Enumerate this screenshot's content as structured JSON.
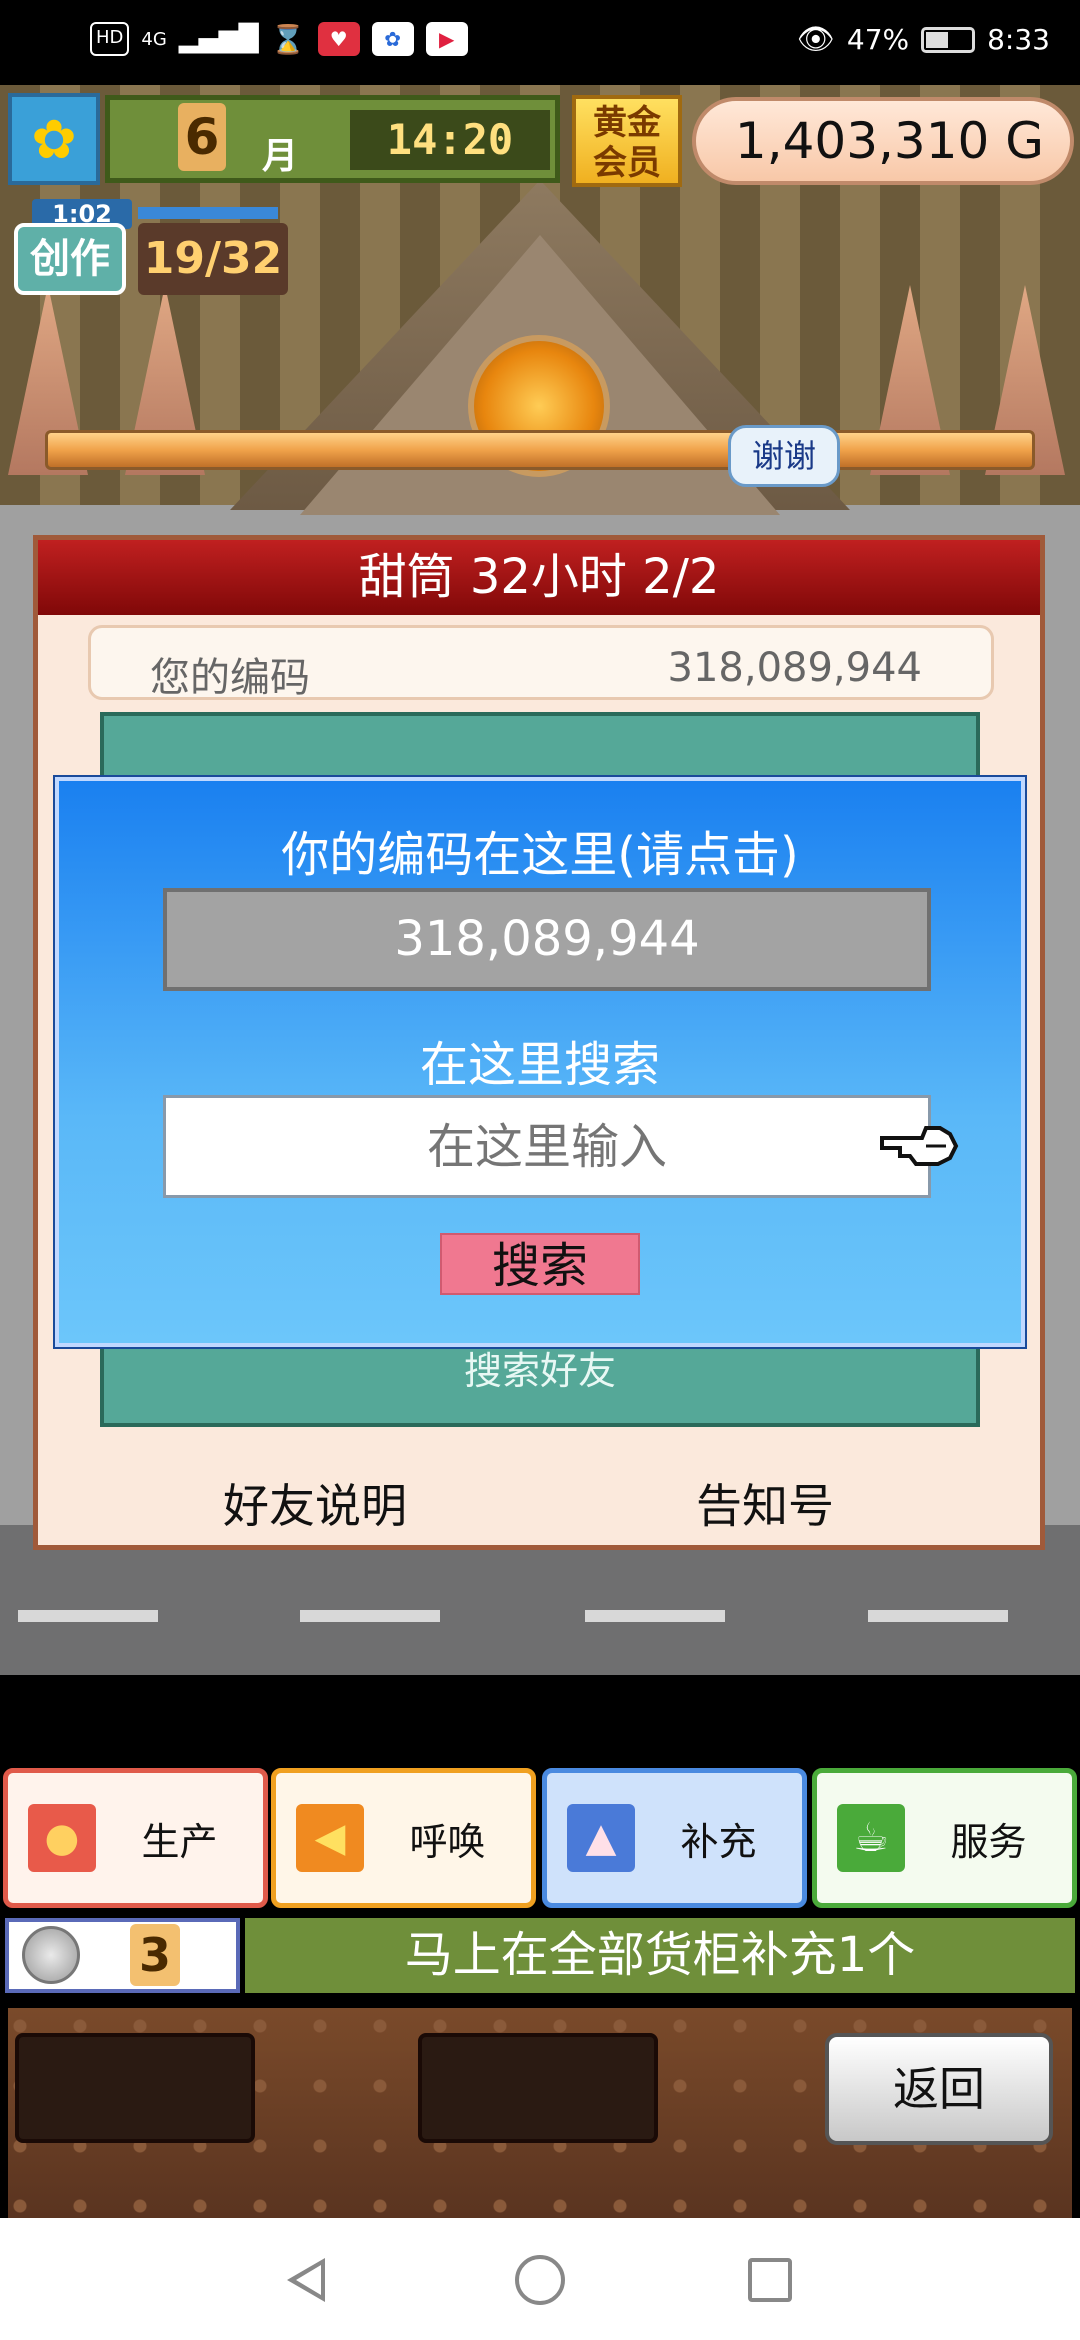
{
  "status_bar": {
    "network": "4G",
    "battery": "47%",
    "time": "8:33"
  },
  "hud": {
    "month": "6",
    "month_label": "月",
    "clock": "14:20",
    "gold_badge": "黄金\n会员",
    "money": "1,403,310 G"
  },
  "create": {
    "timer": "1:02",
    "label": "创作",
    "count": "19/32"
  },
  "thanks_bubble": "谢谢",
  "panel": {
    "header": "甜筒  32小时 2/2",
    "code_label": "您的编码",
    "code_value": "318,089,944",
    "teal_label": "搜索好友",
    "friends_explain": "好友说明",
    "notice_number": "告知号"
  },
  "dialog": {
    "code_title": "你的编码在这里(请点击)",
    "code_button": "318,089,944",
    "search_title": "在这里搜索",
    "search_placeholder": "在这里输入",
    "search_button": "搜索"
  },
  "tabs": [
    {
      "label": "生产",
      "icon": "bread-icon"
    },
    {
      "label": "呼唤",
      "icon": "megaphone-icon"
    },
    {
      "label": "补充",
      "icon": "cake-icon"
    },
    {
      "label": "服务",
      "icon": "coffee-icon"
    }
  ],
  "supply": {
    "coin_count": "3",
    "message": "马上在全部货柜补充1个"
  },
  "back_button": "返回",
  "colors": {
    "dialog_top": "#1a80f0",
    "dialog_bottom": "#6cc6fa",
    "panel_header": "#a01010",
    "search_button": "#f07890",
    "info_bar": "#6f8f3a"
  }
}
